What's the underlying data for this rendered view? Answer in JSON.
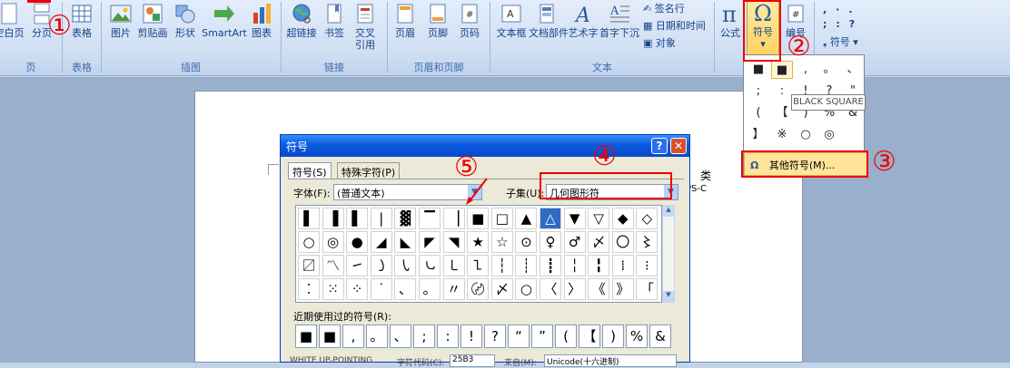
{
  "ribbon": {
    "page_group": {
      "blank_page": "空白页",
      "page_break": "分页",
      "label": "页"
    },
    "table_group": {
      "table": "表格",
      "label": "表格"
    },
    "illustration_group": {
      "picture": "图片",
      "clipart": "剪贴画",
      "shapes": "形状",
      "smartart": "SmartArt",
      "chart": "图表",
      "label": "插图"
    },
    "links_group": {
      "hyperlink": "超链接",
      "bookmark": "书签",
      "crossref_line1": "交叉",
      "crossref_line2": "引用",
      "label": "链接"
    },
    "header_group": {
      "header": "页眉",
      "footer": "页脚",
      "page_number": "页码",
      "label": "页眉和页脚"
    },
    "text_group": {
      "textbox": "文本框",
      "quickparts": "文档部件",
      "wordart": "艺术字",
      "dropcap": "首字下沉",
      "signature": "签名行",
      "datetime": "日期和时间",
      "object": "对象",
      "label": "文本"
    },
    "symbols_group": {
      "equation": "公式",
      "symbol": "符号",
      "number": "编号",
      "special": "符号"
    }
  },
  "annotations": {
    "a1": "①",
    "a2": "②",
    "a3": "③",
    "a4": "④",
    "a5": "⑤"
  },
  "symbol_dropdown": {
    "cells": [
      "■",
      "■",
      ",",
      "。",
      "、",
      ";",
      ":",
      "!",
      "?",
      "\"",
      "(",
      "【",
      ")",
      "%",
      "&",
      "】",
      "※",
      "○",
      "◎"
    ],
    "tooltip": "BLACK SQUARE",
    "more_symbols": "其他符号(M)..."
  },
  "page_text": {
    "right_char": "类",
    "right_code": "PS-C"
  },
  "dialog": {
    "title": "符号",
    "tab_symbols": "符号(S)",
    "tab_special": "特殊字符(P)",
    "font_label": "字体(F):",
    "font_value": "(普通文本)",
    "subset_label": "子集(U):",
    "subset_value": "几何图形符",
    "grid": [
      "▌",
      "▐",
      "▌",
      "|",
      "▓",
      "▔",
      "▕",
      "■",
      "□",
      "▲",
      "△",
      "▼",
      "▽",
      "◆",
      "◇",
      "○",
      "◎",
      "●",
      "◢",
      "◣",
      "◤",
      "◥",
      "★",
      "☆",
      "⊙",
      "♀",
      "♂",
      "〆",
      "〇",
      "〻",
      "〼",
      "〽",
      "㇀",
      "㇁",
      "㇂",
      "㇃",
      "㇄",
      "㇅",
      "┆",
      "┊",
      "┋",
      "╎",
      "╏",
      "⁞",
      "⁝",
      "⁚",
      "⁙",
      "⁘",
      "˙",
      "、",
      "。",
      "〃",
      "〄",
      "〆",
      "○",
      "〈",
      "〉",
      "《",
      "》",
      "「"
    ],
    "recent_label": "近期使用过的符号(R):",
    "recent": [
      "■",
      "■",
      ",",
      "。",
      "、",
      ";",
      ":",
      "!",
      "?",
      "“",
      "”",
      "(",
      "【",
      ")",
      "%",
      "&"
    ],
    "bottom_left": "WHITE UP-POINTING",
    "bottom_code_label": "字符代码(C):",
    "bottom_code": "25B3",
    "bottom_from_label": "来自(M):",
    "bottom_from": "Unicode(十六进制)"
  },
  "colors": {
    "annotation": "#ee0000",
    "title_bar": "#0a5ae0",
    "ribbon": "#cfdef2"
  }
}
